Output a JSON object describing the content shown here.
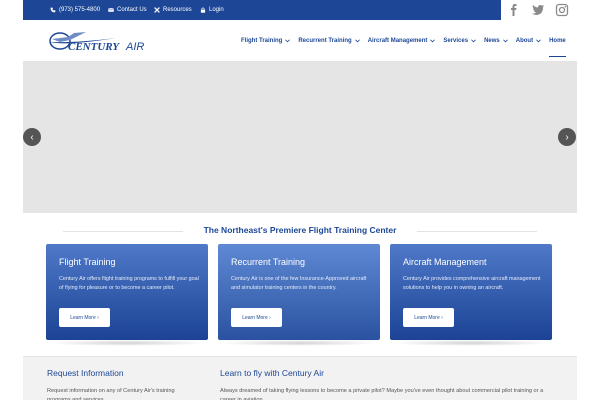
{
  "topbar": {
    "phone": "(973) 575-4800",
    "contact": "Contact Us",
    "resources": "Resources",
    "login": "Login"
  },
  "social": [
    "facebook-icon",
    "twitter-icon",
    "instagram-icon"
  ],
  "brand": {
    "logo_text_1": "CENTURY",
    "logo_text_2": "AIR"
  },
  "nav": {
    "items": [
      {
        "label": "Flight Training",
        "dropdown": true
      },
      {
        "label": "Recurrent Training",
        "dropdown": true
      },
      {
        "label": "Aircraft Management",
        "dropdown": true
      },
      {
        "label": "Services",
        "dropdown": true
      },
      {
        "label": "News",
        "dropdown": true
      },
      {
        "label": "About",
        "dropdown": true
      }
    ],
    "home": "Home"
  },
  "slider": {
    "prev": "‹",
    "next": "›"
  },
  "section": {
    "title": "The Northeast's Premiere Flight Training Center"
  },
  "cards": [
    {
      "title": "Flight Training",
      "text": "Century Air offers flight training programs to fulfill your goal of flying for pleasure or to become a career pilot.",
      "button": "Learn More ›"
    },
    {
      "title": "Recurrent Training",
      "text": "Century Air is one of the few Insurance-Approved aircraft and simulator training centers in the country.",
      "button": "Learn More ›"
    },
    {
      "title": "Aircraft Management",
      "text": "Century Air provides comprehensive aircraft management solutions to help you in owning an aircraft.",
      "button": "Learn More ›"
    }
  ],
  "bottom": {
    "left_title": "Request Information",
    "left_text": "Request information on any of Century Air's training programs and services.",
    "right_title": "Learn to fly with Century Air",
    "right_text": "Always dreamed of taking flying lessons to become a private pilot? Maybe you've even thought about commercial pilot training or a career in aviation."
  },
  "colors": {
    "brand": "#1d4796",
    "card_gradient_top": "#4f79c8",
    "card_gradient_bottom": "#1c4395"
  }
}
